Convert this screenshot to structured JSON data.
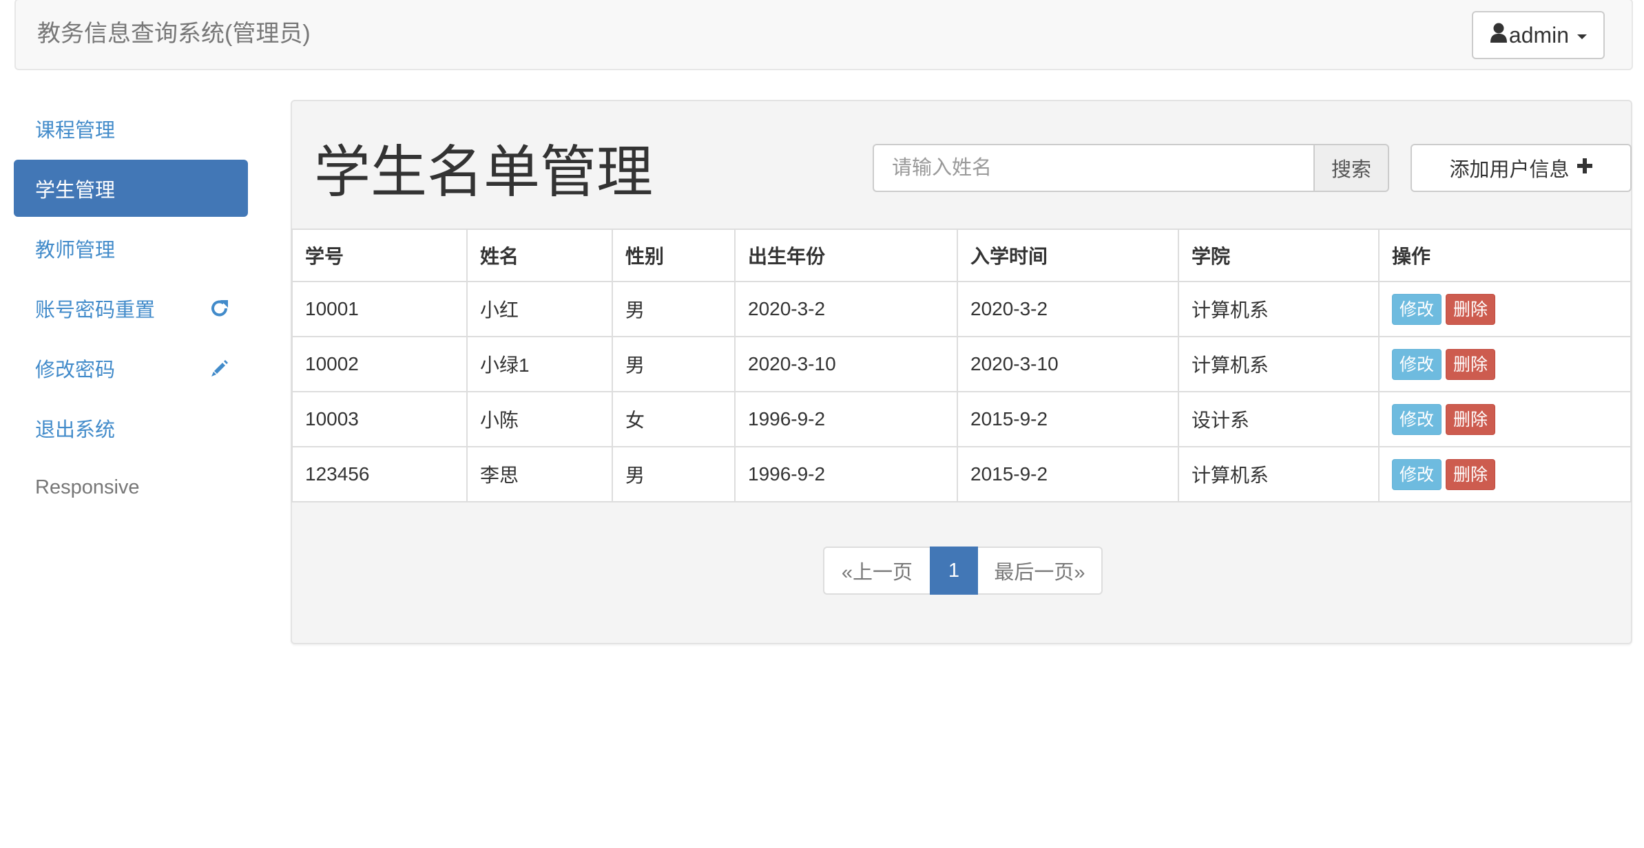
{
  "navbar": {
    "brand": "教务信息查询系统(管理员)",
    "user": {
      "icon": "user-icon",
      "label": "admin",
      "caret_icon": "caret-down-icon"
    }
  },
  "sidebar": {
    "items": [
      {
        "label": "课程管理",
        "active": false
      },
      {
        "label": "学生管理",
        "active": true
      },
      {
        "label": "教师管理",
        "active": false
      },
      {
        "label": "账号密码重置",
        "active": false,
        "icon": "refresh-icon"
      },
      {
        "label": "修改密码",
        "active": false,
        "icon": "pencil-icon"
      },
      {
        "label": "退出系统",
        "active": false
      },
      {
        "label": "Responsive",
        "active": false
      }
    ]
  },
  "main": {
    "title": "学生名单管理",
    "search": {
      "placeholder": "请输入姓名",
      "value": "",
      "button_label": "搜索"
    },
    "add_button": {
      "label": "添加用户信息",
      "icon": "plus-icon"
    },
    "table": {
      "headers": [
        "学号",
        "姓名",
        "性别",
        "出生年份",
        "入学时间",
        "学院",
        "操作"
      ],
      "rows": [
        {
          "id": "10001",
          "name": "小红",
          "gender": "男",
          "birth": "2020-3-2",
          "enroll": "2020-3-2",
          "college": "计算机系",
          "edit": "修改",
          "delete": "删除"
        },
        {
          "id": "10002",
          "name": "小绿1",
          "gender": "男",
          "birth": "2020-3-10",
          "enroll": "2020-3-10",
          "college": "计算机系",
          "edit": "修改",
          "delete": "删除"
        },
        {
          "id": "10003",
          "name": "小陈",
          "gender": "女",
          "birth": "1996-9-2",
          "enroll": "2015-9-2",
          "college": "设计系",
          "edit": "修改",
          "delete": "删除"
        },
        {
          "id": "123456",
          "name": "李思",
          "gender": "男",
          "birth": "1996-9-2",
          "enroll": "2015-9-2",
          "college": "计算机系",
          "edit": "修改",
          "delete": "删除"
        }
      ]
    },
    "pagination": {
      "prev": "«上一页",
      "current": "1",
      "next": "最后一页»"
    }
  },
  "colors": {
    "primary": "#4277b6",
    "link": "#428bca",
    "info": "#6ebbdf",
    "danger": "#cd5c4f"
  }
}
